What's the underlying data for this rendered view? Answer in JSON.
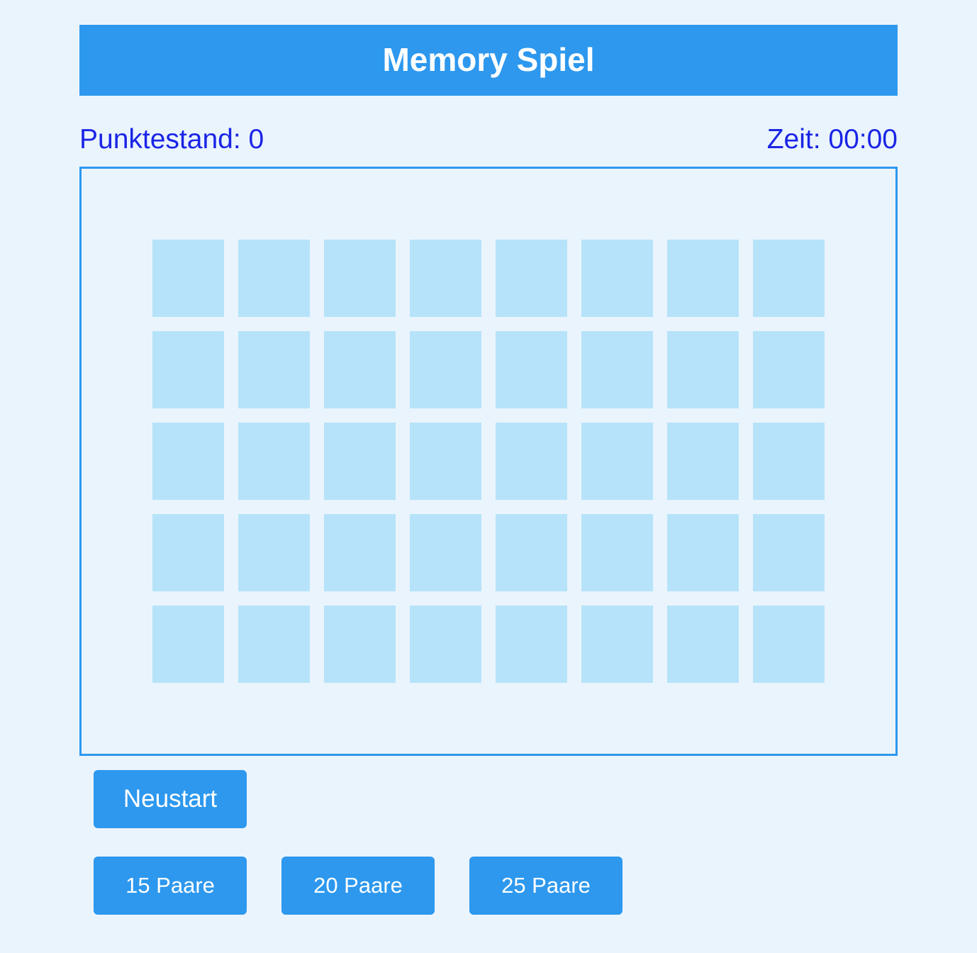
{
  "header": {
    "title": "Memory Spiel"
  },
  "status": {
    "score": "Punktestand: 0",
    "time": "Zeit: 00:00"
  },
  "board": {
    "rows": 5,
    "columns": 8,
    "cards_face_down": 40
  },
  "controls": {
    "restart_label": "Neustart",
    "pair_options": [
      "15 Paare",
      "20 Paare",
      "25 Paare"
    ]
  },
  "colors": {
    "page_background": "#eaf4fd",
    "accent": "#2d98ee",
    "status_text": "#1a25e6",
    "card_back": "#b6e3f9"
  }
}
